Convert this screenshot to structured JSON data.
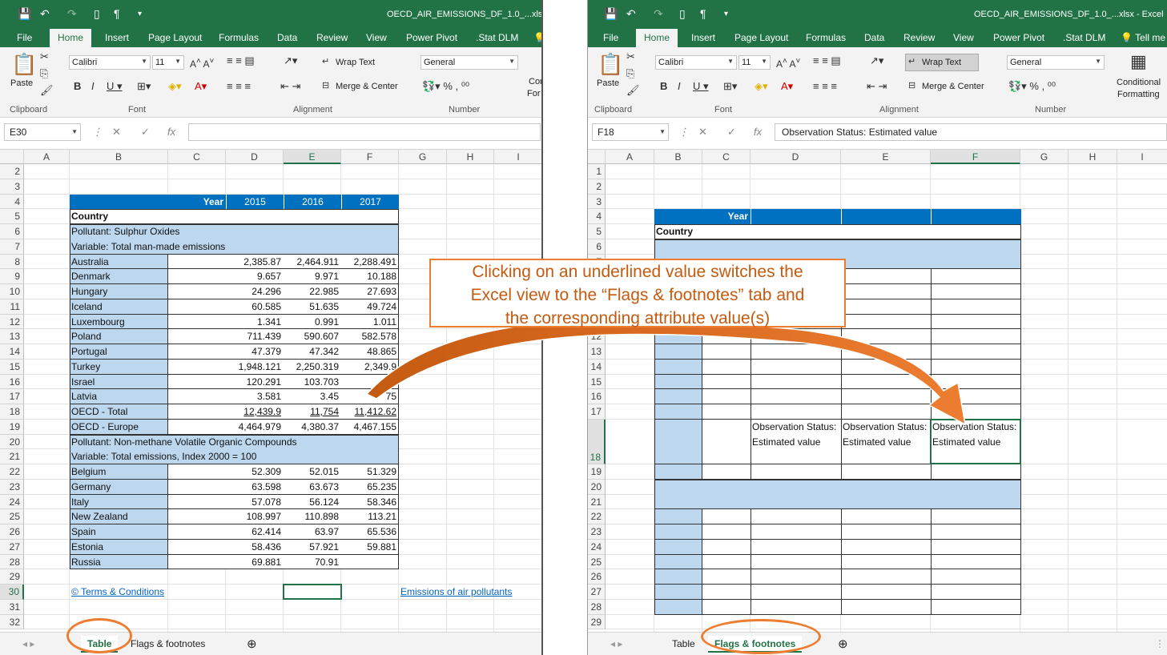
{
  "left": {
    "title_file": "OECD_AIR_EMISSIONS_DF_1.0_...xlsx - E",
    "tabs": [
      "File",
      "Home",
      "Insert",
      "Page Layout",
      "Formulas",
      "Data",
      "Review",
      "View",
      "Power Pivot",
      ".Stat DLM"
    ],
    "ribbon": {
      "paste": "Paste",
      "clipboard": "Clipboard",
      "font_name": "Calibri",
      "font_size": "11",
      "font_group": "Font",
      "wrap_text": "Wrap Text",
      "merge_center": "Merge & Center",
      "alignment": "Alignment",
      "number_format": "General",
      "number": "Number",
      "cond_partial": "Cor",
      "cond_partial2": "For"
    },
    "namebox": "E30",
    "formula": "",
    "columns": [
      "A",
      "B",
      "C",
      "D",
      "E",
      "F",
      "G",
      "H",
      "I"
    ],
    "rows": [
      "2",
      "3",
      "4",
      "5",
      "6",
      "7",
      "8",
      "9",
      "10",
      "11",
      "12",
      "13",
      "14",
      "15",
      "16",
      "17",
      "18",
      "19",
      "20",
      "21",
      "22",
      "23",
      "24",
      "25",
      "26",
      "27",
      "28",
      "29",
      "30",
      "31",
      "32"
    ],
    "table": {
      "year_label": "Year",
      "years": [
        "2015",
        "2016",
        "2017"
      ],
      "country": "Country",
      "pollutant1": "Pollutant: Sulphur Oxides",
      "variable1": "Variable: Total man-made emissions",
      "pollutant2": "Pollutant: Non-methane Volatile Organic Compounds",
      "variable2": "Variable: Total emissions, Index 2000 = 100",
      "rows1": [
        {
          "c": "Australia",
          "v": [
            "2,385.87",
            "2,464.911",
            "2,288.491"
          ]
        },
        {
          "c": "Denmark",
          "v": [
            "9.657",
            "9.971",
            "10.188"
          ]
        },
        {
          "c": "Hungary",
          "v": [
            "24.296",
            "22.985",
            "27.693"
          ]
        },
        {
          "c": "Iceland",
          "v": [
            "60.585",
            "51.635",
            "49.724"
          ]
        },
        {
          "c": "Luxembourg",
          "v": [
            "1.341",
            "0.991",
            "1.011"
          ]
        },
        {
          "c": "Poland",
          "v": [
            "711.439",
            "590.607",
            "582.578"
          ]
        },
        {
          "c": "Portugal",
          "v": [
            "47.379",
            "47.342",
            "48.865"
          ]
        },
        {
          "c": "Turkey",
          "v": [
            "1,948.121",
            "2,250.319",
            "2,349.9"
          ]
        },
        {
          "c": "Israel",
          "v": [
            "120.291",
            "103.703",
            ""
          ]
        },
        {
          "c": "Latvia",
          "v": [
            "3.581",
            "3.45",
            "75"
          ]
        },
        {
          "c": "OECD - Total",
          "v": [
            "12,439.9",
            "11,754",
            "11,412.62"
          ]
        },
        {
          "c": "OECD - Europe",
          "v": [
            "4,464.979",
            "4,380.37",
            "4,467.155"
          ]
        }
      ],
      "rows2": [
        {
          "c": "Belgium",
          "v": [
            "52.309",
            "52.015",
            "51.329"
          ]
        },
        {
          "c": "Germany",
          "v": [
            "63.598",
            "63.673",
            "65.235"
          ]
        },
        {
          "c": "Italy",
          "v": [
            "57.078",
            "56.124",
            "58.346"
          ]
        },
        {
          "c": "New Zealand",
          "v": [
            "108.997",
            "110.898",
            "113.21"
          ]
        },
        {
          "c": "Spain",
          "v": [
            "62.414",
            "63.97",
            "65.536"
          ]
        },
        {
          "c": "Estonia",
          "v": [
            "58.436",
            "57.921",
            "59.881"
          ]
        },
        {
          "c": "Russia",
          "v": [
            "69.881",
            "70.91",
            ""
          ]
        }
      ],
      "terms": "© Terms & Conditions",
      "emissions_link": "Emissions of air pollutants"
    },
    "sheets": [
      "Table",
      "Flags & footnotes"
    ]
  },
  "right": {
    "title_file": "OECD_AIR_EMISSIONS_DF_1.0_...xlsx - Excel",
    "tabs": [
      "File",
      "Home",
      "Insert",
      "Page Layout",
      "Formulas",
      "Data",
      "Review",
      "View",
      "Power Pivot",
      ".Stat DLM",
      "Tell me"
    ],
    "ribbon": {
      "paste": "Paste",
      "clipboard": "Clipboard",
      "font_name": "Calibri",
      "font_size": "11",
      "font_group": "Font",
      "wrap_text": "Wrap Text",
      "merge_center": "Merge & Center",
      "alignment": "Alignment",
      "number_format": "General",
      "number": "Number",
      "conditional": "Conditional",
      "formatting": "Formatting"
    },
    "namebox": "F18",
    "formula": "Observation Status: Estimated value",
    "columns": [
      "A",
      "B",
      "C",
      "D",
      "E",
      "F",
      "G",
      "H",
      "I"
    ],
    "rows": [
      "1",
      "2",
      "3",
      "4",
      "5",
      "6",
      "7",
      "8",
      "9",
      "10",
      "11",
      "12",
      "13",
      "14",
      "15",
      "16",
      "17",
      "18",
      "19",
      "20",
      "21",
      "22",
      "23",
      "24",
      "25",
      "26",
      "27",
      "28",
      "29"
    ],
    "year_label": "Year",
    "country": "Country",
    "obs": "Observation Status: Estimated value",
    "sheets": [
      "Table",
      "Flags & footnotes"
    ]
  },
  "callout": [
    "Clicking on an underlined value switches the",
    "Excel view to the “Flags & footnotes” tab and",
    "the corresponding attribute value(s)"
  ],
  "colors": {
    "excel_green": "#217346",
    "header_blue": "#0070c0",
    "light_blue": "#bdd7ee",
    "highlight": "#ed7d31"
  }
}
